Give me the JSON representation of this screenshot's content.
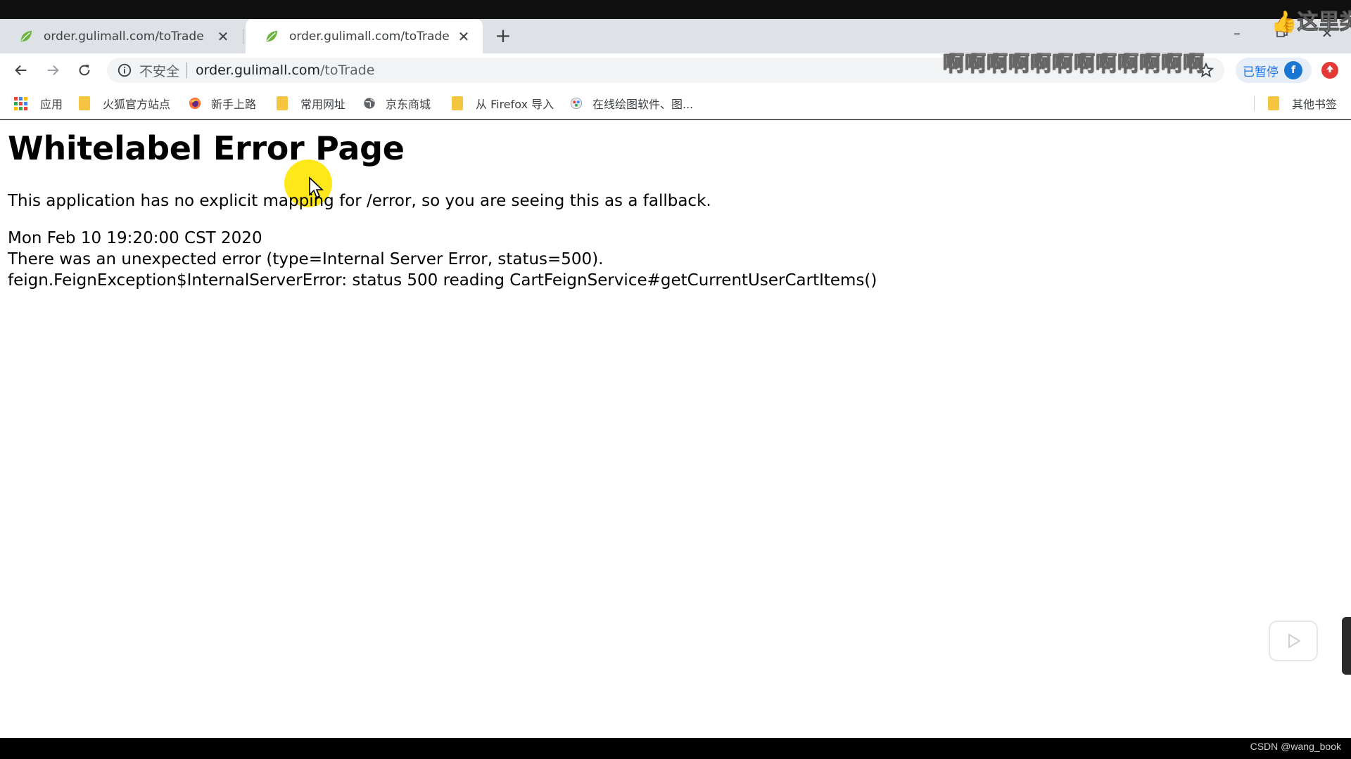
{
  "browser": {
    "tabs": [
      {
        "title": "order.gulimall.com/toTrade",
        "active": false
      },
      {
        "title": "order.gulimall.com/toTrade",
        "active": true
      }
    ],
    "close_glyph": "✕",
    "new_tab_glyph": "+",
    "address_bar": {
      "security_label": "不安全",
      "url_host": "order.gulimall.com",
      "url_path": "/toTrade"
    },
    "profile": {
      "status_label": "已暂停",
      "avatar_letter": "f"
    }
  },
  "bookmarks": {
    "items": [
      {
        "label": "应用",
        "icon": "apps-grid-icon"
      },
      {
        "label": "火狐官方站点",
        "icon": "folder-icon"
      },
      {
        "label": "新手上路",
        "icon": "firefox-icon"
      },
      {
        "label": "常用网址",
        "icon": "folder-icon"
      },
      {
        "label": "京东商城",
        "icon": "globe-icon"
      },
      {
        "label": "从 Firefox 导入",
        "icon": "folder-icon"
      },
      {
        "label": "在线绘图软件、图...",
        "icon": "drawing-app-icon"
      }
    ],
    "other_bookmarks_label": "其他书签"
  },
  "page": {
    "title": "Whitelabel Error Page",
    "message": "This application has no explicit mapping for /error, so you are seeing this as a fallback.",
    "timestamp": "Mon Feb 10 19:20:00 CST 2020",
    "error_line": "There was an unexpected error (type=Internal Server Error, status=500).",
    "exception_line": "feign.FeignException$InternalServerError: status 500 reading CartFeignService#getCurrentUserCartItems()"
  },
  "overlays": {
    "danmaku_text": "啊啊啊啊啊啊啊啊啊啊啊啊",
    "top_right_text": "这里类",
    "watermark": "CSDN @wang_book"
  },
  "colors": {
    "tab_strip": "#dee1e6",
    "accent_blue": "#1a73e8",
    "folder_yellow": "#f5c542",
    "cursor_highlight": "#ffe600"
  }
}
